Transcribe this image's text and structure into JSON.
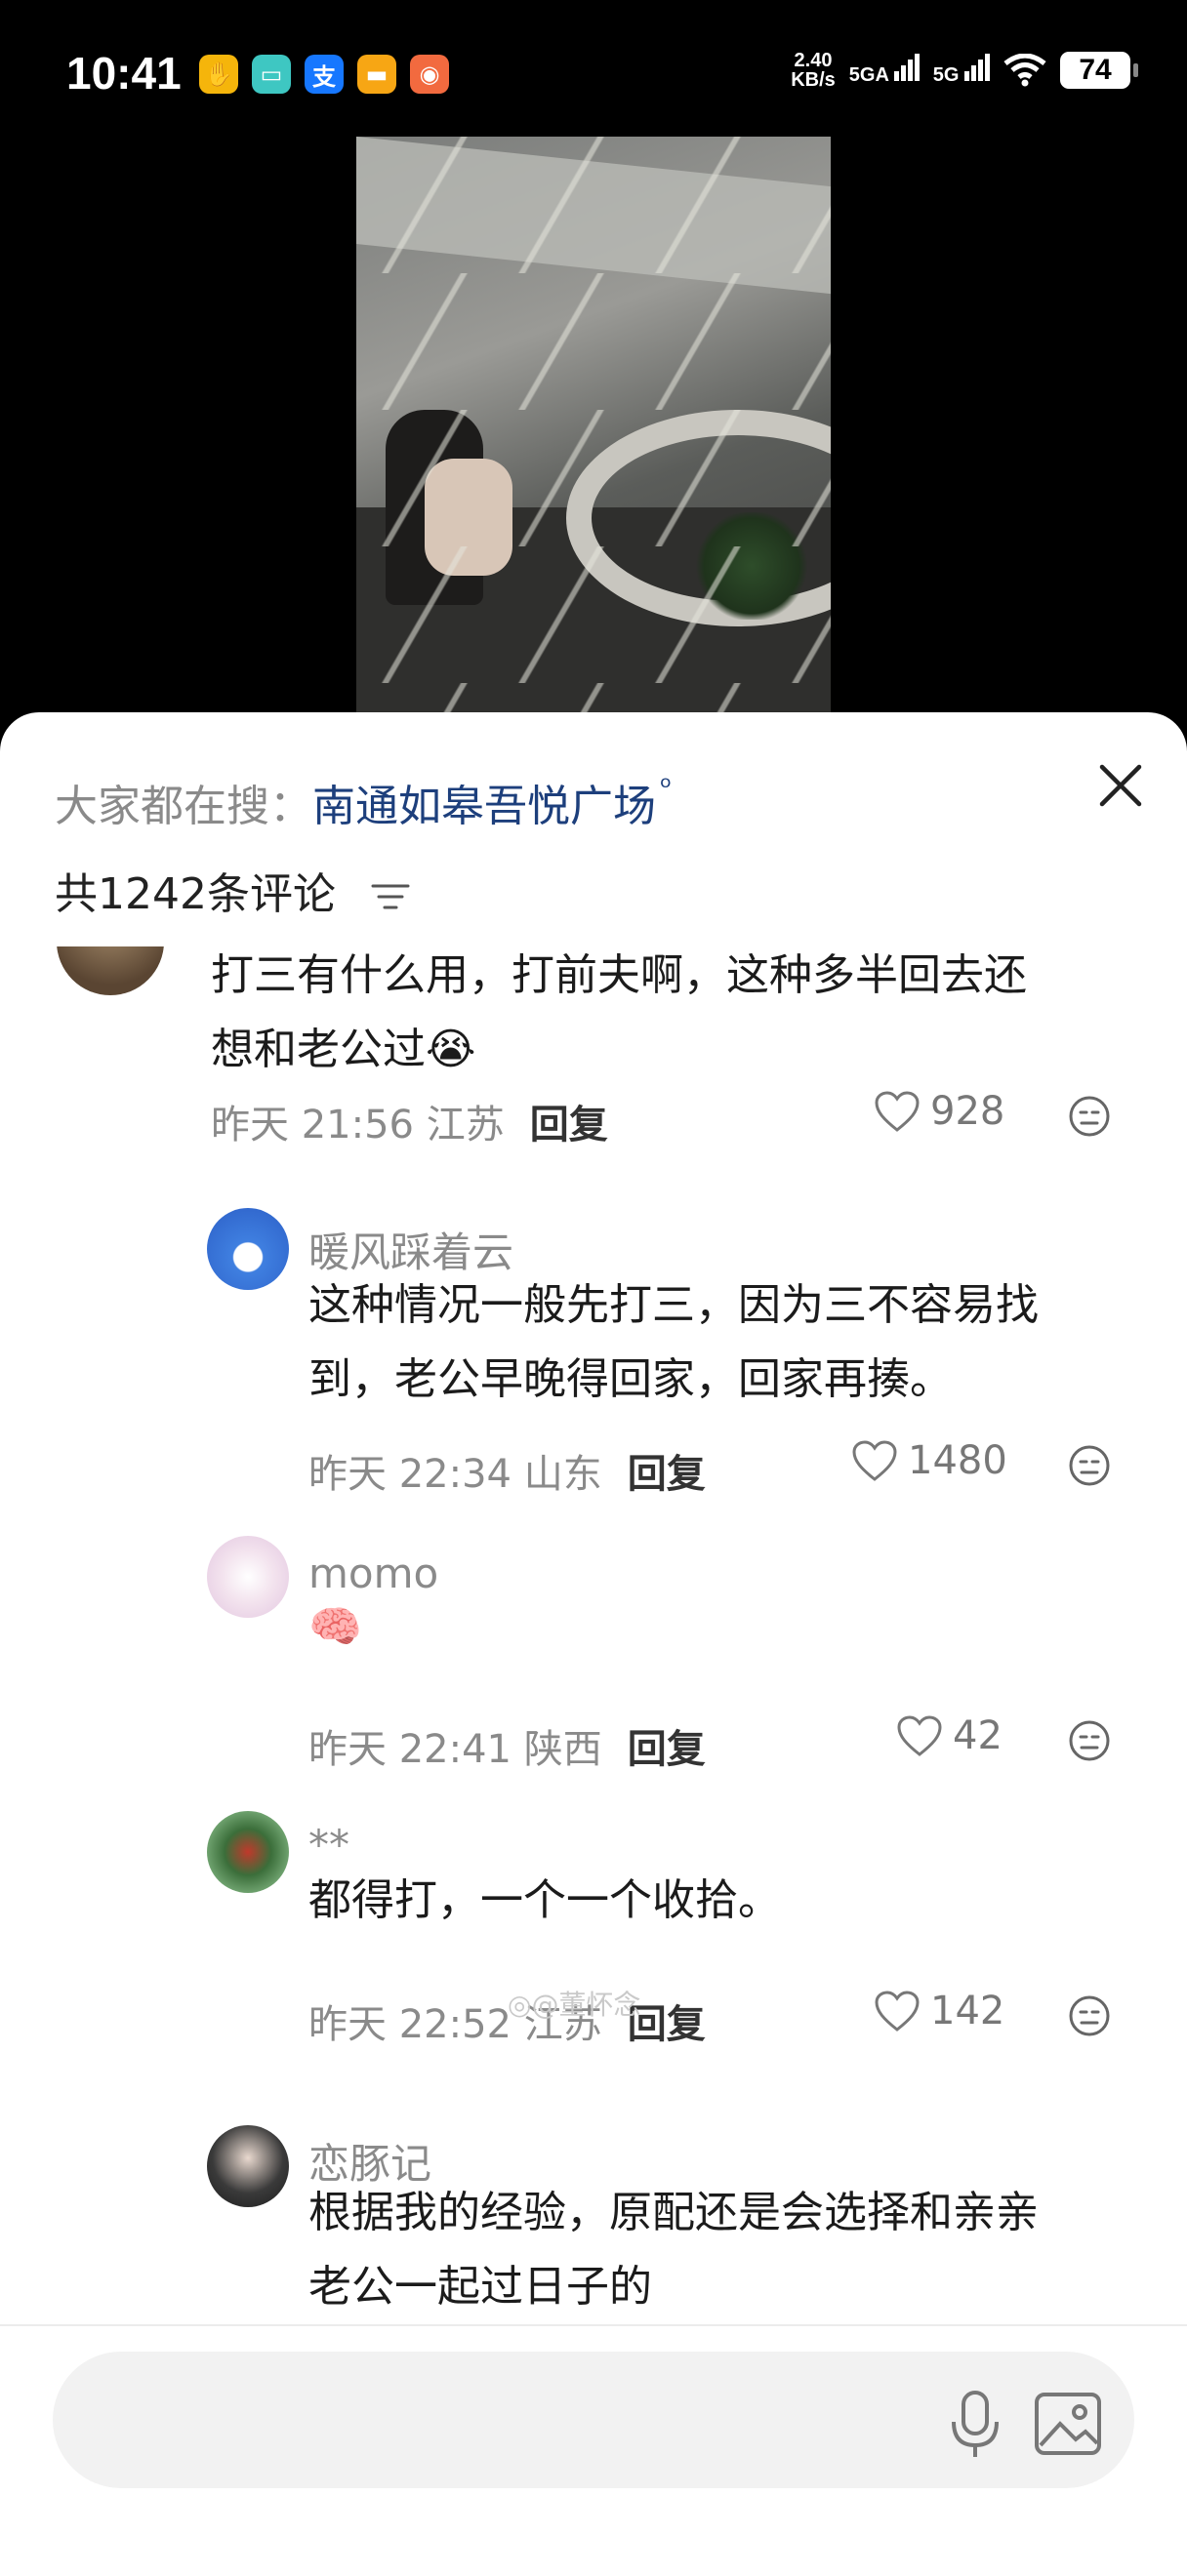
{
  "status_bar": {
    "time": "10:41",
    "net_speed_top": "2.40",
    "net_speed_bottom": "KB/s",
    "signal1": "5GA",
    "signal2": "5G",
    "battery": "74",
    "app_icons": [
      {
        "name": "hand-app-icon",
        "glyph": "✋",
        "color": "#f5b50b"
      },
      {
        "name": "chat-app-icon",
        "glyph": "▭",
        "color": "#3ec7c2"
      },
      {
        "name": "alipay-icon",
        "glyph": "支",
        "color": "#1677ff"
      },
      {
        "name": "card-app-icon",
        "glyph": "▬",
        "color": "#f7a614"
      },
      {
        "name": "rabbit-app-icon",
        "glyph": "◉",
        "color": "#f26a3f"
      }
    ]
  },
  "sheet": {
    "hot_search_label": "大家都在搜：",
    "hot_search_term": "南通如皋吾悦广场",
    "comment_count": "共1242条评论"
  },
  "comments": [
    {
      "text_line1": "打三有什么用，打前夫啊，这种多半回去还",
      "text_line2": "想和老公过",
      "emoji": "😭",
      "time": "昨天 21:56 江苏",
      "reply": "回复",
      "likes": "928"
    },
    {
      "user": "暖风踩着云",
      "text_line1": "这种情况一般先打三，因为三不容易找",
      "text_line2": "到，老公早晚得回家，回家再揍。",
      "time": "昨天 22:34 山东",
      "reply": "回复",
      "likes": "1480"
    },
    {
      "user": "momo",
      "text_line1": "🧠",
      "time": "昨天 22:41 陕西",
      "reply": "回复",
      "likes": "42"
    },
    {
      "user": "**",
      "text_line1": "都得打，一个一个收拾。",
      "time": "昨天 22:52 江苏",
      "reply": "回复",
      "likes": "142"
    },
    {
      "user": "恋豚记",
      "text_line1": "根据我的经验，原配还是会选择和亲亲",
      "text_line2": "老公一起过日子的"
    }
  ],
  "watermark": "@董怀念",
  "colors": {
    "accent": "#1d3f7c",
    "secondary_text": "#8a8a8a"
  }
}
